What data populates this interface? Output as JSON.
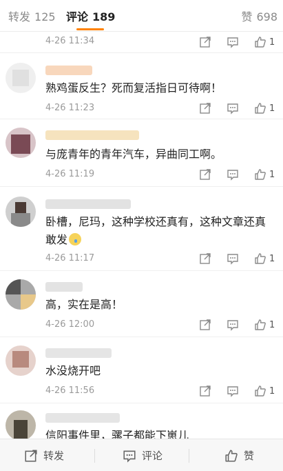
{
  "tabs": {
    "repost": {
      "label": "转发",
      "count": "125"
    },
    "comment": {
      "label": "评论",
      "count": "189"
    },
    "like": {
      "label": "赞",
      "count": "698"
    }
  },
  "comments": [
    {
      "time": "4-26 11:34",
      "text": "",
      "likes": "1"
    },
    {
      "time": "4-26 11:23",
      "text": "熟鸡蛋反生？死而复活指日可待啊！",
      "likes": "1"
    },
    {
      "time": "4-26 11:19",
      "text": "与庞青年的青年汽车，异曲同工啊。",
      "likes": "1"
    },
    {
      "time": "4-26 11:17",
      "text": "卧槽，尼玛，这种学校还真有，这种文章还真敢发",
      "likes": "1",
      "emoji": "crying-face"
    },
    {
      "time": "4-26 12:00",
      "text": "高，实在是高！",
      "likes": "1"
    },
    {
      "time": "4-26 11:56",
      "text": "水没烧开吧",
      "likes": "1"
    },
    {
      "time": "",
      "text": "信阳事件里，骡子都能下崽儿",
      "likes": ""
    }
  ],
  "actions": {
    "share_icon": "share-icon",
    "reply_icon": "comment-icon",
    "like_icon": "thumbs-up-icon"
  },
  "bottom_bar": {
    "repost": "转发",
    "comment": "评论",
    "like": "赞"
  },
  "colors": {
    "accent": "#ff8200",
    "name_blur_orange": "#f7d7b8",
    "name_blur_gray": "#d9d9d9"
  }
}
